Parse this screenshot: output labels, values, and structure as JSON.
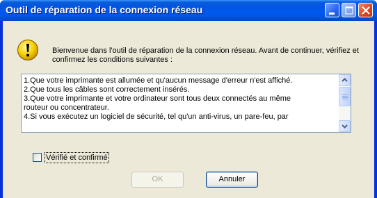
{
  "window": {
    "title": "Outil de réparation de la connexion réseau",
    "controls": [
      "minimize-icon",
      "maximize-icon",
      "close-icon"
    ]
  },
  "intro": {
    "icon": "warning-icon",
    "text": "Bienvenue dans l'outil de réparation de la connexion réseau. Avant de continuer, vérifiez et confirmez les conditions suivantes :"
  },
  "conditions": {
    "lines": [
      "1.Que votre imprimante est allumée et qu'aucun message d'erreur n'est affiché.",
      "2.Que tous les câbles sont correctement insérés.",
      "3.Que votre imprimante et votre ordinateur sont tous deux connectés au même",
      "routeur ou concentrateur.",
      "4.Si vous exécutez un logiciel de sécurité, tel qu'un anti-virus, un pare-feu, par"
    ]
  },
  "checkbox": {
    "label": "Vérifié et confirmé",
    "checked": false
  },
  "buttons": {
    "ok": "OK",
    "cancel": "Annuler"
  },
  "colors": {
    "titlebar": "#0058ee",
    "dialog_bg": "#ece9d8",
    "warning": "#f8d000"
  }
}
